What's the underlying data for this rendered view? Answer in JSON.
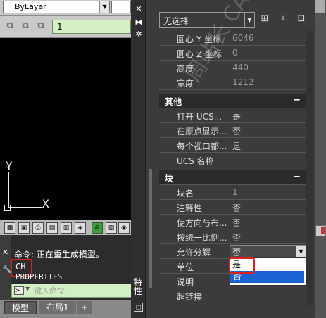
{
  "toolbar": {
    "layer_select_value": "ByLayer",
    "current_layer": "1"
  },
  "canvas": {
    "ucs_y": "Y",
    "ucs_x": "X"
  },
  "command": {
    "history_line": "命令: 正在重生成模型。",
    "entered": "CH",
    "echo": "PROPERTIES",
    "placeholder": "键入命令"
  },
  "tabs": {
    "model": "模型",
    "layout1": "布局1",
    "add": "+"
  },
  "palette": {
    "title": "特性",
    "selection": "无选择",
    "rows_geometry": [
      {
        "label": "圆心 Y 坐标",
        "value": "6046"
      },
      {
        "label": "圆心 Z 坐标",
        "value": "0"
      },
      {
        "label": "高度",
        "value": "440"
      },
      {
        "label": "宽度",
        "value": "1212"
      }
    ],
    "cat_misc": {
      "label": "其他",
      "toggle": "−"
    },
    "rows_misc": [
      {
        "label": "打开 UCS...",
        "value": "是"
      },
      {
        "label": "在原点显示...",
        "value": "否"
      },
      {
        "label": "每个视口都...",
        "value": "是"
      },
      {
        "label": "UCS 名称",
        "value": ""
      }
    ],
    "cat_block": {
      "label": "块",
      "toggle": "−"
    },
    "rows_block": [
      {
        "label": "块名",
        "value": "1"
      },
      {
        "label": "注释性",
        "value": "否"
      },
      {
        "label": "使方向与布...",
        "value": "否"
      },
      {
        "label": "按统一比例...",
        "value": "否"
      },
      {
        "label": "允许分解",
        "value": "否"
      },
      {
        "label": "单位",
        "value": ""
      },
      {
        "label": "说明",
        "value": ""
      },
      {
        "label": "超链接",
        "value": ""
      }
    ],
    "explode_options": [
      "是",
      "否"
    ],
    "watermark": "周站长 CAD  www.zzcad.com"
  },
  "icons": [
    "close-icon",
    "pin-icon",
    "settings-icon",
    "quick-select-icon",
    "select-objects-icon",
    "pickadd-icon",
    "wrench-icon"
  ],
  "colors": {
    "palette_bg": "#3b3b3b",
    "command_input_bg": "#d3f0c4",
    "highlight_red": "#e0201a",
    "selected_option": "#1a61d1"
  }
}
